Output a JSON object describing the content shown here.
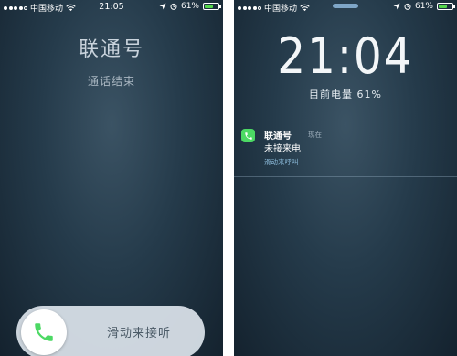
{
  "left_screen": {
    "status_bar": {
      "carrier": "中国移动",
      "time": "21:05",
      "battery_percent": "61%",
      "battery_level": 0.61
    },
    "caller": "联通号",
    "call_status": "通话结束",
    "slider_label": "滑动来接听"
  },
  "right_screen": {
    "status_bar": {
      "carrier": "中国移动",
      "battery_percent": "61%",
      "battery_level": 0.61
    },
    "clock": "21:04",
    "battery_text": "目前电量 61%",
    "notification": {
      "app": "联通号",
      "time": "现在",
      "message": "未接来电",
      "action": "滑动来呼叫"
    }
  },
  "colors": {
    "battery_green": "#55d64c",
    "phone_green": "#4cd964"
  },
  "icons": {
    "signal": "signal-dots-icon",
    "wifi": "wifi-icon",
    "location": "location-arrow-icon",
    "alarm": "alarm-clock-icon",
    "battery": "battery-icon",
    "phone": "phone-icon"
  }
}
